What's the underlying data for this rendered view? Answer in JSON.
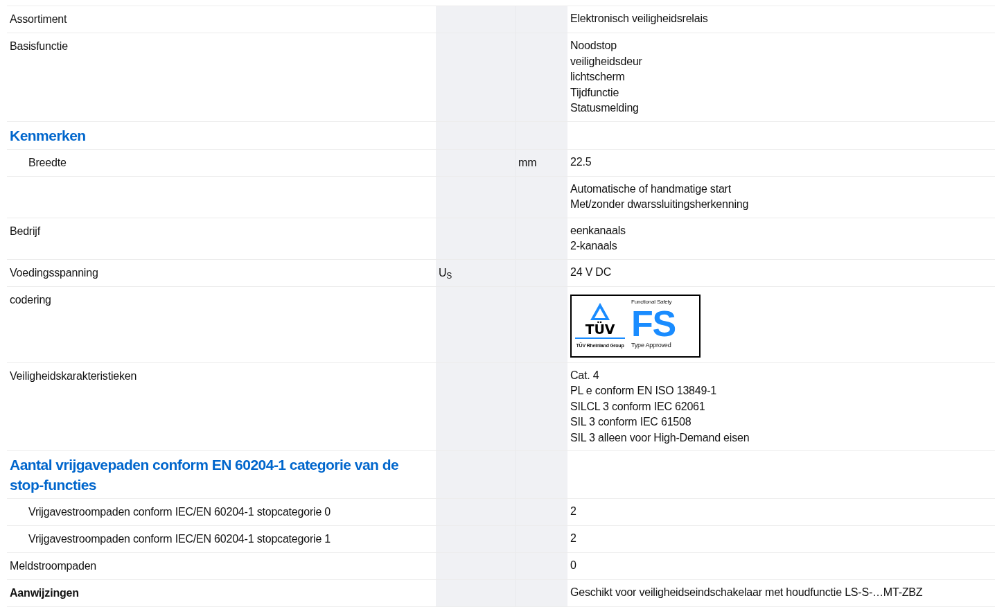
{
  "rows": [
    {
      "kind": "row",
      "label": "Assortiment",
      "indent": false,
      "values": [
        "Elektronisch veiligheidsrelais"
      ]
    },
    {
      "kind": "row",
      "label": "Basisfunctie",
      "indent": false,
      "values": [
        "Noodstop",
        "veiligheidsdeur",
        "lichtscherm",
        "Tijdfunctie",
        "Statusmelding"
      ]
    },
    {
      "kind": "heading",
      "label": "Kenmerken"
    },
    {
      "kind": "row",
      "label": "Breedte",
      "indent": true,
      "unit": "mm",
      "values": [
        "22.5"
      ]
    },
    {
      "kind": "row",
      "values": [
        "Automatische of handmatige start",
        "Met/zonder dwarssluitingsherkenning"
      ]
    },
    {
      "kind": "row",
      "label": "Bedrijf",
      "indent": false,
      "values": [
        "eenkanaals",
        "2-kanaals"
      ]
    },
    {
      "kind": "row",
      "label": "Voedingsspanning",
      "indent": false,
      "symbol": "U$_{S}$",
      "values": [
        "24 V DC"
      ]
    },
    {
      "kind": "logo",
      "label": "codering",
      "logo": {
        "brand": "TÜV",
        "group": "TÜV Rheinland Group",
        "top": "Functional Safety",
        "mark": "FS",
        "bottom": "Type Approved"
      }
    },
    {
      "kind": "row",
      "label": "Veiligheidskarakteristieken",
      "indent": false,
      "values": [
        "Cat. 4",
        "PL e conform EN ISO 13849-1",
        "SILCL 3 conform IEC 62061",
        "SIL 3 conform IEC 61508",
        "SIL 3 alleen voor High-Demand eisen"
      ]
    },
    {
      "kind": "heading",
      "label": "Aantal vrijgavepaden conform EN 60204-1 categorie van de stop-functies"
    },
    {
      "kind": "row",
      "label": "Vrijgavestroompaden conform IEC/EN 60204-1 stopcategorie 0",
      "indent": true,
      "values": [
        "2"
      ]
    },
    {
      "kind": "row",
      "label": "Vrijgavestroompaden conform IEC/EN 60204-1 stopcategorie 1",
      "indent": true,
      "values": [
        "2"
      ]
    },
    {
      "kind": "row",
      "label": "Meldstroompaden",
      "indent": false,
      "values": [
        "0"
      ]
    },
    {
      "kind": "strong",
      "label": "Aanwijzingen",
      "indent": false,
      "values": [
        "Geschikt voor veiligheidseindschakelaar met houdfunctie LS-S-…MT-ZBZ"
      ]
    }
  ]
}
